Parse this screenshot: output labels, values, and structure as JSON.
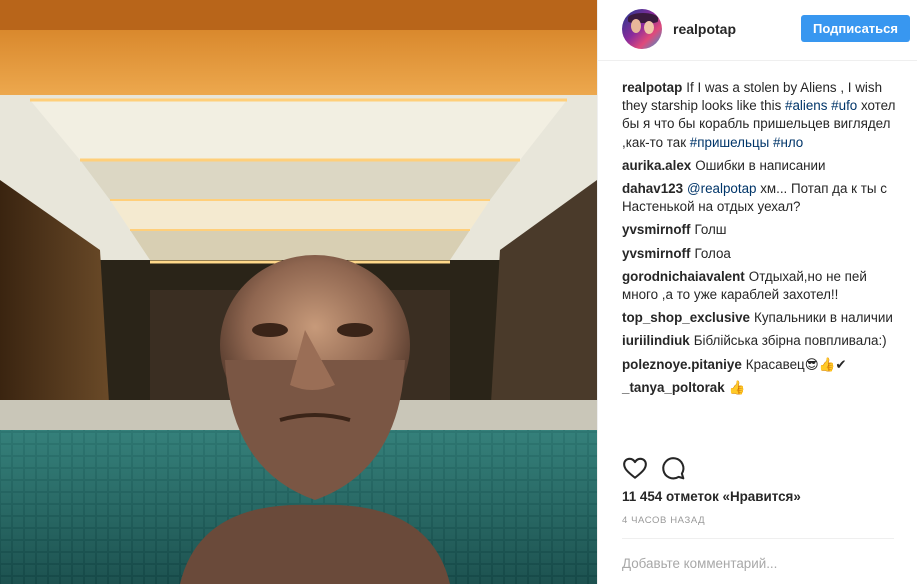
{
  "photo": {
    "alt_subject": "pool-selfie"
  },
  "header": {
    "username": "realpotap",
    "follow_label": "Подписаться"
  },
  "caption": {
    "user": "realpotap",
    "parts": [
      "If I was a stolen by Aliens , I wish they starship looks like this ",
      "#aliens",
      " ",
      "#ufo",
      " хотел бы я что бы корабль пришельцев вигляделкак-то так "
    ],
    "text_pre": "If I was a stolen by Aliens , I wish they starship looks like this ",
    "tag1": "#aliens",
    "tag2": "#ufo",
    "text_mid": " хотел бы я что бы корабль пришельцев виглядел ,как-то так ",
    "tag3": "#пришельцы",
    "tag4": "#нло"
  },
  "comments": [
    {
      "user": "aurika.alex",
      "text": "Ошибки в написании"
    },
    {
      "user": "dahav123",
      "mention": "@realpotap",
      "text": " хм... Потап да к ты с Настенькой на отдых уехал?"
    },
    {
      "user": "yvsmirnoff",
      "text": "Голш"
    },
    {
      "user": "yvsmirnoff",
      "text": "Голоа"
    },
    {
      "user": "gorodnichaiavalent",
      "text": "Отдыхай,но не пей много ,а то уже караблей захотел!!"
    },
    {
      "user": "top_shop_exclusive",
      "text": "Купальники в наличии"
    },
    {
      "user": "iuriilindiuk",
      "text": "Біблійська збірна повпливала:)"
    },
    {
      "user": "poleznoye.pitaniye",
      "text": "Красавец😎👍✔"
    },
    {
      "user": "_tanya_poltorak",
      "text": "👍"
    }
  ],
  "actions": {
    "like_icon": "heart-icon",
    "comment_icon": "comment-icon"
  },
  "likes": "11 454 отметок «Нравится»",
  "time": "4 часов назад",
  "add_comment": {
    "placeholder": "Добавьте комментарий..."
  },
  "colors": {
    "accent": "#3897f0",
    "hashtag": "#003569",
    "muted": "#999999"
  }
}
